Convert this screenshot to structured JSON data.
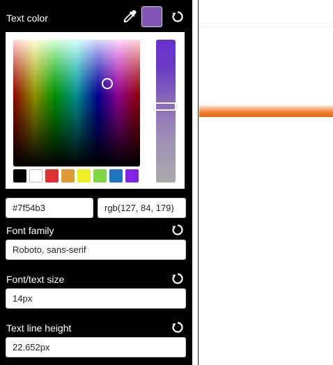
{
  "panel": {
    "text_color": {
      "label": "Text color",
      "current_swatch": "#7f54b3",
      "hex_value": "#7f54b3",
      "rgb_value": "rgb(127, 84, 179)",
      "presets": [
        "#000000",
        "#ffffff",
        "#dd3333",
        "#dd9933",
        "#eeee22",
        "#81d742",
        "#1e73be",
        "#8224e3"
      ]
    },
    "font_family": {
      "label": "Font family",
      "value": "Roboto, sans-serif"
    },
    "font_size": {
      "label": "Font/text size",
      "value": "14px"
    },
    "line_height": {
      "label": "Text line height",
      "value": "22.652px"
    }
  },
  "icons": {
    "eyedropper": "eyedropper-icon",
    "reset": "reset-icon"
  },
  "colors": {
    "panel_bg": "#000000",
    "accent_orange": "#ec6a17"
  }
}
